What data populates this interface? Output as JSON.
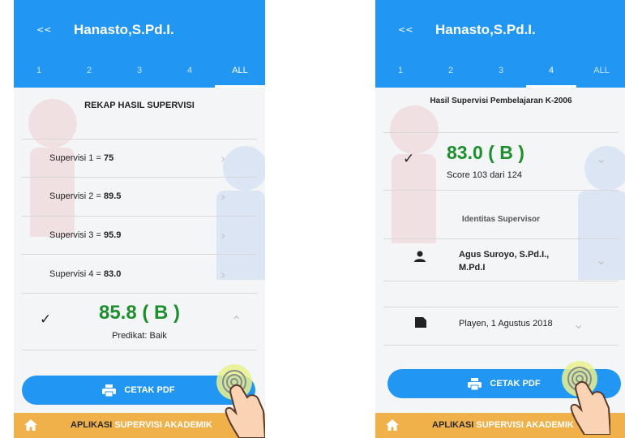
{
  "left": {
    "title": "Hanasto,S.Pd.I.",
    "back_label": "<<",
    "tabs": [
      "1",
      "2",
      "3",
      "4",
      "ALL"
    ],
    "heading": "REKAP HASIL SUPERVISI",
    "rows": [
      {
        "label": "Supervisi 1 = ",
        "value": "75"
      },
      {
        "label": "Supervisi 2 = ",
        "value": "89.5"
      },
      {
        "label": "Supervisi 3 = ",
        "value": "95.9"
      },
      {
        "label": "Supervisi 4 = ",
        "value": "83.0"
      }
    ],
    "score": "85.8 ( B )",
    "predikat": "Predikat: Baik",
    "pdf_label": "CETAK PDF",
    "footer_a": "APLIKASI",
    "footer_b": "SUPERVISI AKADEMIK"
  },
  "right": {
    "title": "Hanasto,S.Pd.I.",
    "back_label": "<<",
    "tabs": [
      "1",
      "2",
      "3",
      "4",
      "ALL"
    ],
    "heading": "Hasil Supervisi Pembelajaran K-2006",
    "score": "83.0 ( B )",
    "score_detail": "Score 103 dari 124",
    "supervisor_heading": "Identitas Supervisor",
    "supervisor_name_1": "Agus Suroyo, S.Pd.I.,",
    "supervisor_name_2": "M.Pd.I",
    "place_date": "Playen, 1 Agustus 2018",
    "pdf_label": "CETAK PDF",
    "footer_a": "APLIKASI",
    "footer_b": "SUPERVISI AKADEMIK"
  },
  "colors": {
    "primary": "#2196f3",
    "score_green": "#1e8f2e",
    "footer": "#f0b04a"
  }
}
